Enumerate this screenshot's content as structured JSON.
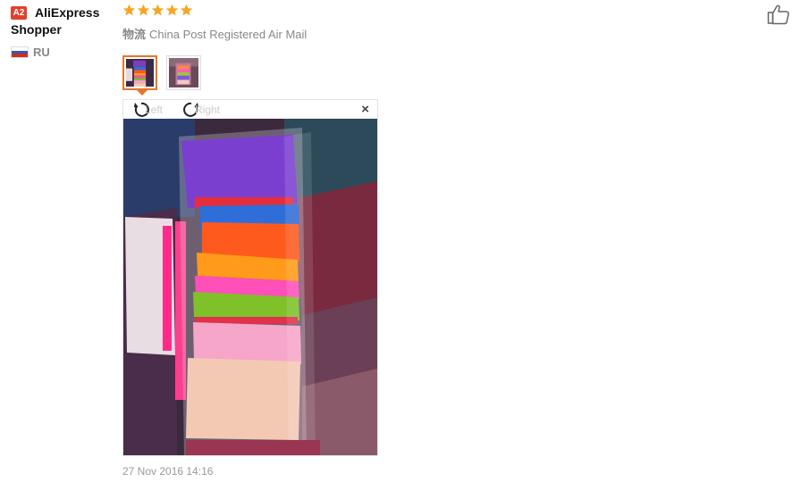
{
  "user": {
    "badge": "A2",
    "name": "AliExpress Shopper",
    "country": "RU"
  },
  "rating": {
    "stars": 5,
    "max": 5
  },
  "logistics": {
    "label": "物流",
    "value": "China Post Registered Air Mail"
  },
  "viewer": {
    "rotate_left_label": "Left",
    "rotate_right_label": "Right",
    "close_label": "×"
  },
  "review": {
    "date": "27 Nov 2016 14:16"
  },
  "colors": {
    "star": "#f5a623",
    "accent": "#e5762c",
    "badge": "#e0412d"
  },
  "icons": {
    "like": "thumbs-up-icon",
    "rotate_left": "rotate-left-icon",
    "rotate_right": "rotate-right-icon",
    "close": "close-icon"
  }
}
